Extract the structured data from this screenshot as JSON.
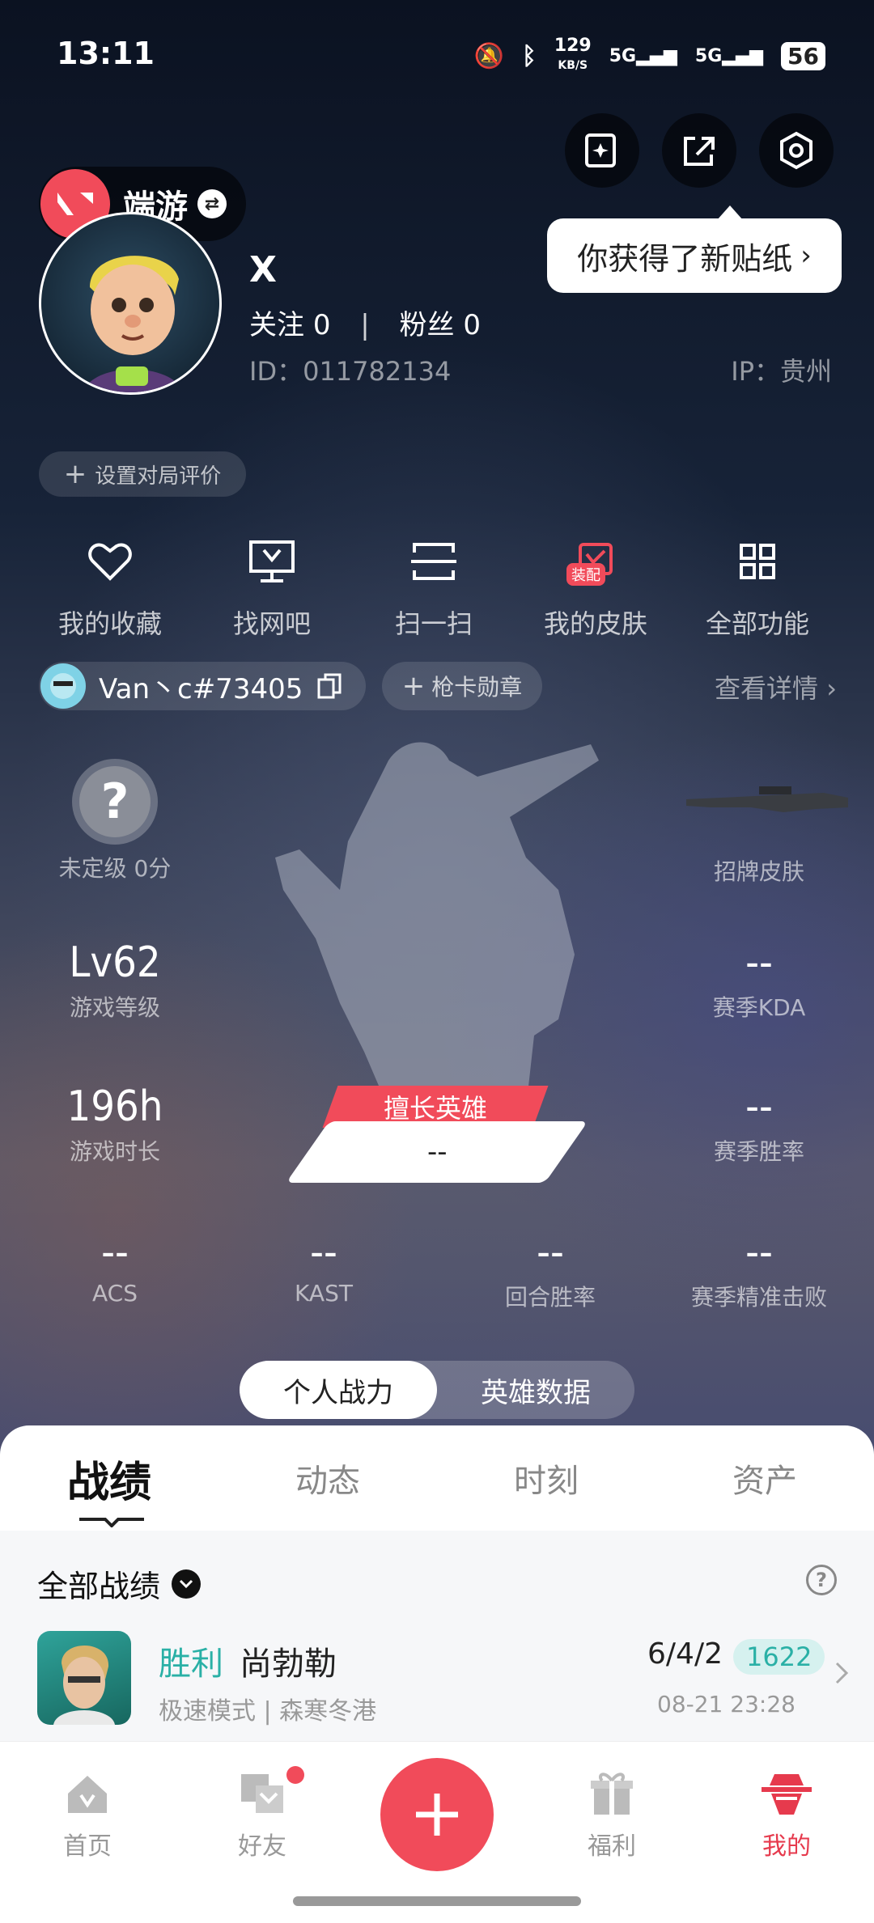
{
  "status": {
    "time": "13:11",
    "net_speed": "129",
    "net_unit": "KB/S",
    "sig1": "5G",
    "sig2": "5G",
    "battery": "56"
  },
  "tooltip": "你获得了新贴纸",
  "switcher": {
    "label": "端游"
  },
  "profile": {
    "name": "X",
    "follow_label": "关注",
    "follow_count": "0",
    "fans_label": "粉丝",
    "fans_count": "0",
    "id": "ID：011782134",
    "ip": "IP：贵州"
  },
  "rate_button": "设置对局评价",
  "quick_actions": [
    {
      "label": "我的收藏",
      "icon": "heart-icon"
    },
    {
      "label": "找网吧",
      "icon": "monitor-icon"
    },
    {
      "label": "扫一扫",
      "icon": "scan-icon"
    },
    {
      "label": "我的皮肤",
      "icon": "skin-icon",
      "badge": "装配"
    },
    {
      "label": "全部功能",
      "icon": "grid-icon"
    }
  ],
  "riot_account": {
    "name": "Van丶c#73405"
  },
  "medal_button": "枪卡勋章",
  "details_link": "查看详情",
  "stats": {
    "rank": {
      "value": "?",
      "label": "未定级 0分"
    },
    "signature_skin": {
      "label": "招牌皮肤"
    },
    "level": {
      "value": "Lv62",
      "label": "游戏等级"
    },
    "kda": {
      "value": "--",
      "label": "赛季KDA"
    },
    "playtime": {
      "value": "196h",
      "label": "游戏时长"
    },
    "winrate": {
      "value": "--",
      "label": "赛季胜率"
    },
    "acs": {
      "value": "--",
      "label": "ACS"
    },
    "kast": {
      "value": "--",
      "label": "KAST"
    },
    "round_win": {
      "value": "--",
      "label": "回合胜率"
    },
    "precise_kill": {
      "value": "--",
      "label": "赛季精准击败"
    }
  },
  "hero": {
    "tag": "擅长英雄",
    "value": "--"
  },
  "segment": {
    "left": "个人战力",
    "right": "英雄数据",
    "selected": "个人战力"
  },
  "tabs": [
    "战绩",
    "动态",
    "时刻",
    "资产"
  ],
  "active_tab": "战绩",
  "filter": "全部战绩",
  "match": {
    "result": "胜利",
    "hero": "尚勃勒",
    "mode": "极速模式 | 森寒冬港",
    "kda": "6/4/2",
    "score": "1622",
    "time": "08-21 23:28"
  },
  "nav": [
    "首页",
    "好友",
    "",
    "福利",
    "我的"
  ],
  "colors": {
    "accent": "#f14b5a",
    "win": "#2ab0a6"
  }
}
